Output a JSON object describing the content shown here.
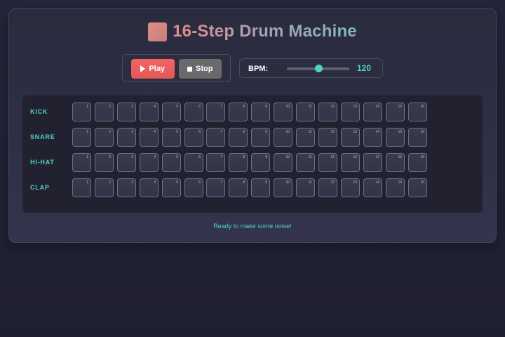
{
  "app": {
    "title": "16-Step Drum Machine",
    "accent_color": "#4fd3c4",
    "play_color": "#f16565"
  },
  "transport": {
    "play_label": "Play",
    "stop_label": "Stop",
    "play_icon": "play-triangle-icon",
    "stop_icon": "stop-square-icon"
  },
  "tempo": {
    "label": "BPM:",
    "value": "120",
    "slider_fraction": 0.5
  },
  "tracks": [
    {
      "name": "KICK",
      "steps": [
        "1",
        "2",
        "3",
        "4",
        "5",
        "6",
        "7",
        "8",
        "9",
        "10",
        "11",
        "12",
        "13",
        "14",
        "15",
        "16"
      ]
    },
    {
      "name": "SNARE",
      "steps": [
        "1",
        "2",
        "3",
        "4",
        "5",
        "6",
        "7",
        "8",
        "9",
        "10",
        "11",
        "12",
        "13",
        "14",
        "15",
        "16"
      ]
    },
    {
      "name": "HI-HAT",
      "steps": [
        "1",
        "2",
        "3",
        "4",
        "5",
        "6",
        "7",
        "8",
        "9",
        "10",
        "11",
        "12",
        "13",
        "14",
        "15",
        "16"
      ]
    },
    {
      "name": "CLAP",
      "steps": [
        "1",
        "2",
        "3",
        "4",
        "5",
        "6",
        "7",
        "8",
        "9",
        "10",
        "11",
        "12",
        "13",
        "14",
        "15",
        "16"
      ]
    }
  ],
  "status": "Ready to make some noise!"
}
